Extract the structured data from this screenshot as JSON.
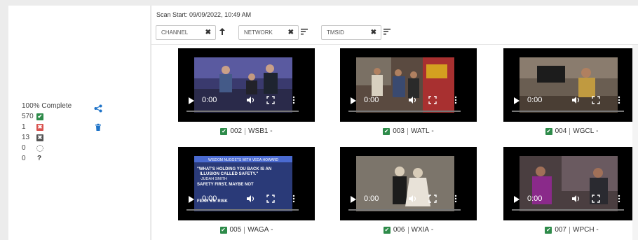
{
  "summary": {
    "complete_label": "100%  Complete",
    "passed": "570",
    "failed": "1",
    "skipped": "13",
    "pending": "0",
    "unknown": "0"
  },
  "header": {
    "scan_start": "Scan Start: 09/09/2022, 10:49 AM"
  },
  "filters": [
    {
      "label": "CHANNEL"
    },
    {
      "label": "NETWORK"
    },
    {
      "label": "TMSID"
    }
  ],
  "clear_glyph": "✖",
  "player_time": "0:00",
  "cards": [
    {
      "num": "002",
      "call": "WSB1",
      "suffix": "-"
    },
    {
      "num": "003",
      "call": "WATL",
      "suffix": "-"
    },
    {
      "num": "004",
      "call": "WGCL",
      "suffix": "-"
    },
    {
      "num": "005",
      "call": "WAGA",
      "suffix": "-"
    },
    {
      "num": "006",
      "call": "WXIA",
      "suffix": "-"
    },
    {
      "num": "007",
      "call": "WPCH",
      "suffix": "-"
    }
  ],
  "thumb5": {
    "banner": "WISDOM NUGGETS WITH VEDA HOWARD",
    "line1": "\"WHAT'S HOLDING YOU BACK IS AN",
    "line2": "ILLUSION CALLED SAFETY.\"",
    "line3": "-JUDAH SMITH",
    "line4": "SAFETY FIRST, MAYBE NOT",
    "line5": "FEAR VS. RISK"
  }
}
